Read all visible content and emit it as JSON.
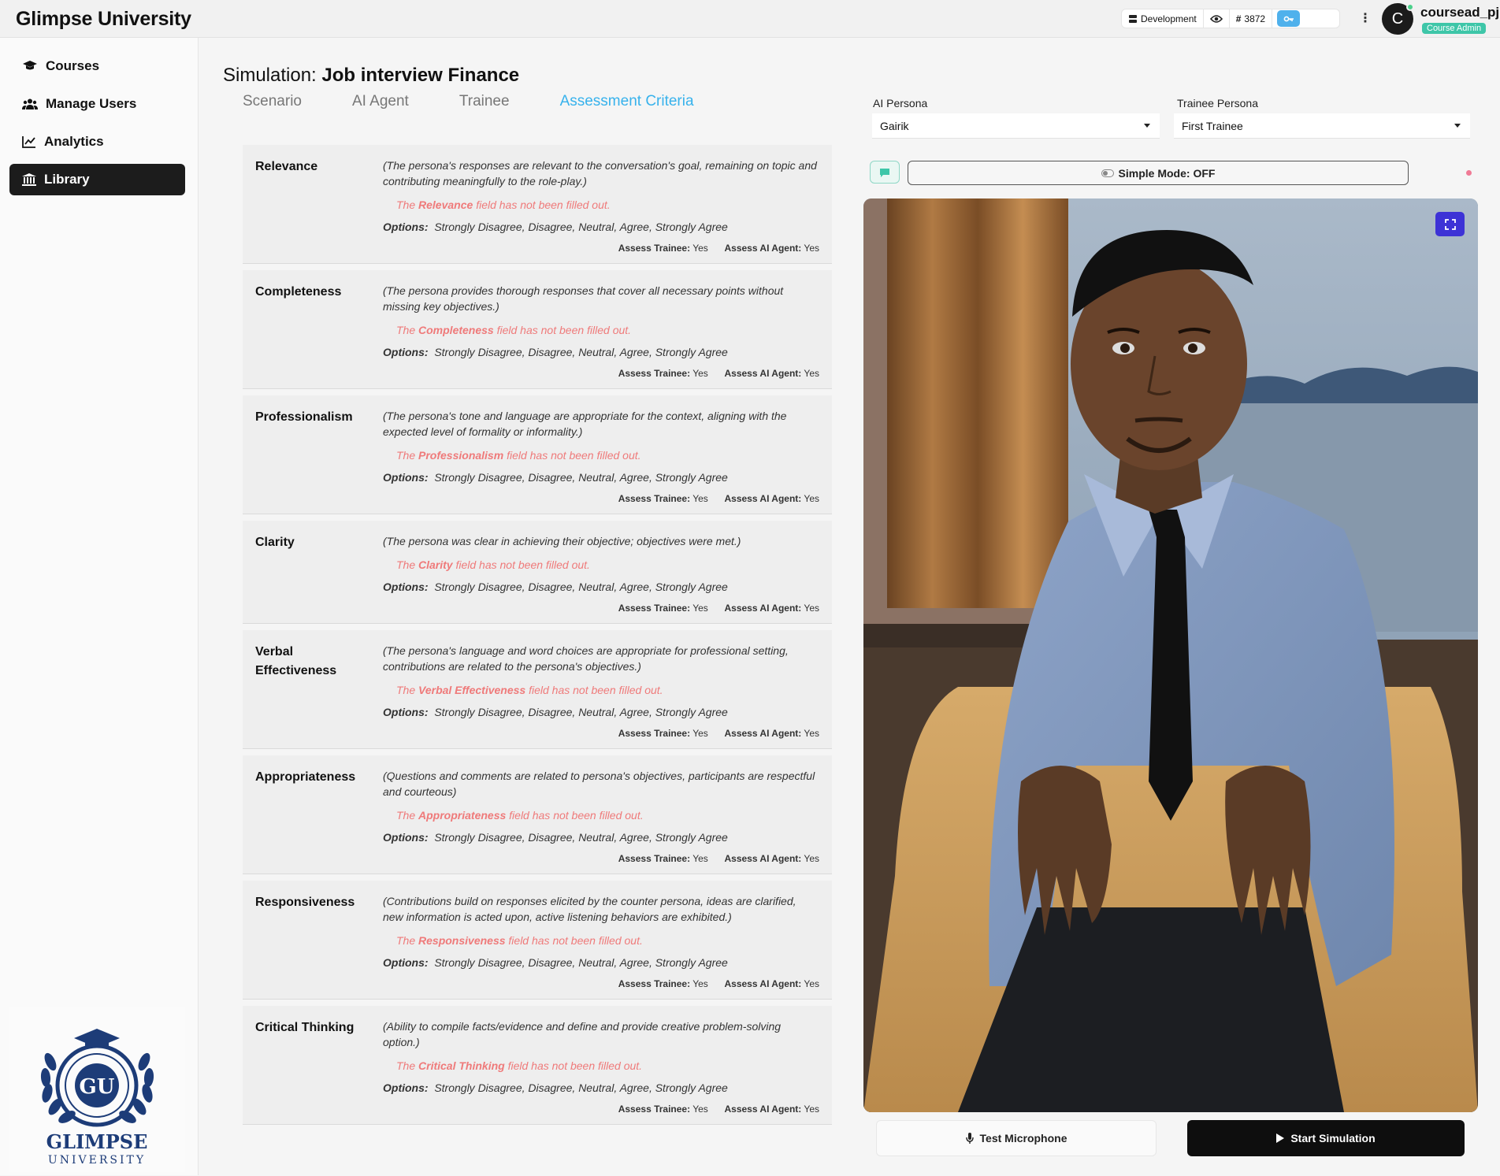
{
  "app": {
    "brand": "Glimpse University"
  },
  "topbar": {
    "environment": "Development",
    "count": "3872",
    "user": {
      "initial": "C",
      "name": "coursead_pj",
      "role": "Course Admin"
    }
  },
  "sidebar": {
    "items": [
      {
        "label": "Courses",
        "icon": "graduation-cap-icon"
      },
      {
        "label": "Manage Users",
        "icon": "users-icon"
      },
      {
        "label": "Analytics",
        "icon": "chart-line-icon"
      },
      {
        "label": "Library",
        "icon": "library-icon",
        "active": true
      }
    ],
    "logo": {
      "title": "GLIMPSE",
      "subtitle": "UNIVERSITY",
      "monogram": "GU"
    }
  },
  "header": {
    "title_label": "Simulation:",
    "title_value": "Job interview Finance",
    "tabs": [
      "Scenario",
      "AI Agent",
      "Trainee",
      "Assessment Criteria"
    ],
    "active_tab": "Assessment Criteria"
  },
  "common": {
    "options_label": "Options:",
    "options_value": "Strongly Disagree, Disagree, Neutral, Agree, Strongly Agree",
    "warn_prefix": "The",
    "warn_suffix": "field has not been filled out.",
    "assess_trainee_label": "Assess Trainee:",
    "assess_trainee_value": "Yes",
    "assess_agent_label": "Assess AI Agent:",
    "assess_agent_value": "Yes"
  },
  "criteria": [
    {
      "name": "Relevance",
      "description": "(The persona's responses are relevant to the conversation's goal, remaining on topic and contributing meaningfully to the role-play.)"
    },
    {
      "name": "Completeness",
      "description": "(The persona provides thorough responses that cover all necessary points without missing key objectives.)"
    },
    {
      "name": "Professionalism",
      "description": "(The persona's tone and language are appropriate for the context, aligning with the expected level of formality or informality.)"
    },
    {
      "name": "Clarity",
      "description": "(The persona was clear in achieving their objective; objectives were met.)"
    },
    {
      "name": "Verbal Effectiveness",
      "description": "(The persona's language and word choices are appropriate for professional setting, contributions are related to the persona's objectives.)"
    },
    {
      "name": "Appropriateness",
      "description": "(Questions and comments are related to persona's objectives, participants are respectful and courteous)"
    },
    {
      "name": "Responsiveness",
      "description": "(Contributions build on responses elicited by the counter persona, ideas are clarified, new information is acted upon, active listening behaviors are exhibited.)"
    },
    {
      "name": "Critical Thinking",
      "description": "(Ability to compile facts/evidence and define and provide creative problem-solving option.)"
    }
  ],
  "right_panel": {
    "ai_persona_label": "AI Persona",
    "ai_persona_value": "Gairik",
    "trainee_persona_label": "Trainee Persona",
    "trainee_persona_value": "First Trainee",
    "simple_mode": "Simple Mode: OFF",
    "test_mic": "Test Microphone",
    "start": "Start Simulation"
  },
  "colors": {
    "accent_tab": "#37b2ec",
    "warn": "#ef7a7a",
    "expand_button": "#3d32d6",
    "key_button": "#4fb1ec",
    "role_badge": "#3ec6a8"
  }
}
